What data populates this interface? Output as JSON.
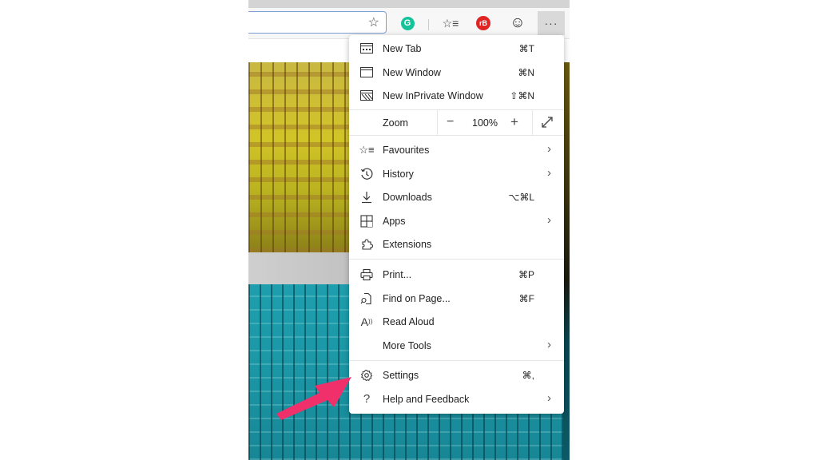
{
  "toolbar": {
    "address_value": "",
    "favorite_star_icon": "star-outline-icon",
    "extensions": [
      {
        "name": "grammarly",
        "glyph": "G",
        "color": "#15c39a"
      },
      {
        "name": "favorites-list",
        "glyph": "☆≡"
      },
      {
        "name": "rb-extension",
        "glyph": "rB",
        "color": "#e02424"
      },
      {
        "name": "feedback-smiley",
        "glyph": "☺"
      }
    ],
    "more_glyph": "···"
  },
  "menu": {
    "items": [
      {
        "id": "new-tab",
        "label": "New Tab",
        "shortcut": "⌘T",
        "icon": "new-tab-icon",
        "submenu": false
      },
      {
        "id": "new-window",
        "label": "New Window",
        "shortcut": "⌘N",
        "icon": "new-window-icon",
        "submenu": false
      },
      {
        "id": "new-inprivate-window",
        "label": "New InPrivate Window",
        "shortcut": "⇧⌘N",
        "icon": "inprivate-icon",
        "submenu": false
      },
      {
        "id": "favourites",
        "label": "Favourites",
        "shortcut": "",
        "icon": "favourites-icon",
        "submenu": true
      },
      {
        "id": "history",
        "label": "History",
        "shortcut": "",
        "icon": "history-icon",
        "submenu": true
      },
      {
        "id": "downloads",
        "label": "Downloads",
        "shortcut": "⌥⌘L",
        "icon": "download-icon",
        "submenu": false
      },
      {
        "id": "apps",
        "label": "Apps",
        "shortcut": "",
        "icon": "apps-icon",
        "submenu": true
      },
      {
        "id": "extensions",
        "label": "Extensions",
        "shortcut": "",
        "icon": "puzzle-icon",
        "submenu": false
      },
      {
        "id": "print",
        "label": "Print...",
        "shortcut": "⌘P",
        "icon": "printer-icon",
        "submenu": false
      },
      {
        "id": "find-on-page",
        "label": "Find on Page...",
        "shortcut": "⌘F",
        "icon": "find-icon",
        "submenu": false
      },
      {
        "id": "read-aloud",
        "label": "Read Aloud",
        "shortcut": "",
        "icon": "read-aloud-icon",
        "submenu": false
      },
      {
        "id": "more-tools",
        "label": "More Tools",
        "shortcut": "",
        "icon": "",
        "submenu": true
      },
      {
        "id": "settings",
        "label": "Settings",
        "shortcut": "⌘,",
        "icon": "gear-icon",
        "submenu": false
      },
      {
        "id": "help-feedback",
        "label": "Help and Feedback",
        "shortcut": "",
        "icon": "help-icon",
        "submenu": true
      }
    ],
    "zoom": {
      "label": "Zoom",
      "minus": "−",
      "value": "100%",
      "plus": "+"
    },
    "chevron": "›"
  },
  "annotation": {
    "arrow_color": "#f0306a",
    "points_to": "Settings"
  }
}
